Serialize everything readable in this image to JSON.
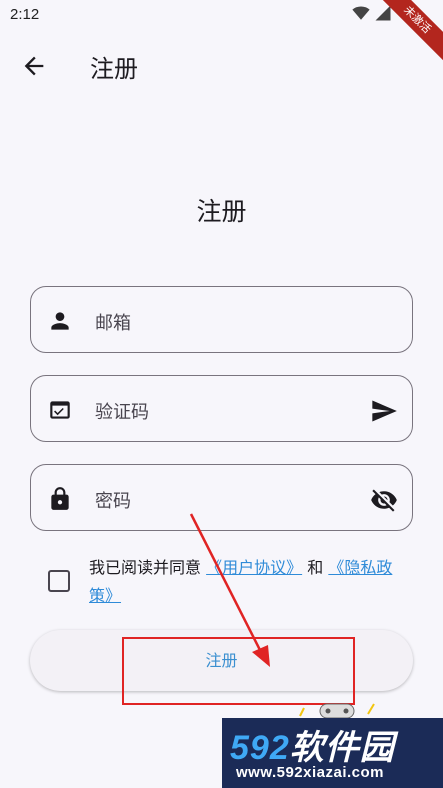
{
  "status_bar": {
    "time": "2:12"
  },
  "debug_banner": "未激活",
  "app_bar": {
    "title": "注册"
  },
  "heading": "注册",
  "fields": {
    "email": {
      "placeholder": "邮箱"
    },
    "code": {
      "placeholder": "验证码"
    },
    "password": {
      "placeholder": "密码"
    }
  },
  "agreement": {
    "prefix": "我已阅读并同意",
    "user_agreement": "《用户协议》",
    "and": "和",
    "privacy_policy": "《隐私政策》"
  },
  "register_button": "注册",
  "watermark": {
    "num": "592",
    "name": "软件园",
    "url": "www.592xiazai.com"
  },
  "colors": {
    "accent": "#3a8fd0",
    "annotation": "#e02424",
    "background": "#f7f6fb"
  }
}
